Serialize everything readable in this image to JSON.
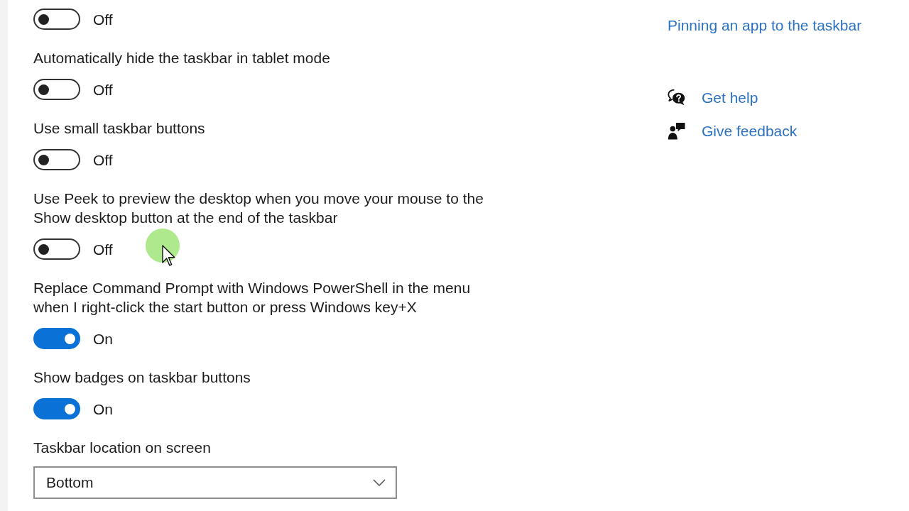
{
  "settings": [
    {
      "kind": "toggle",
      "on": false,
      "state_text": "Off"
    },
    {
      "kind": "toggle",
      "label": "Automatically hide the taskbar in tablet mode",
      "on": false,
      "state_text": "Off"
    },
    {
      "kind": "toggle",
      "label": "Use small taskbar buttons",
      "on": false,
      "state_text": "Off"
    },
    {
      "kind": "toggle",
      "label": "Use Peek to preview the desktop when you move your mouse to the Show desktop button at the end of the taskbar",
      "on": false,
      "state_text": "Off"
    },
    {
      "kind": "toggle",
      "label": "Replace Command Prompt with Windows PowerShell in the menu when I right-click the start button or press Windows key+X",
      "on": true,
      "state_text": "On"
    },
    {
      "kind": "toggle",
      "label": "Show badges on taskbar buttons",
      "on": true,
      "state_text": "On"
    },
    {
      "kind": "dropdown",
      "label": "Taskbar location on screen",
      "value": "Bottom"
    }
  ],
  "related_links": [
    {
      "text": "Pinning an app to the taskbar"
    }
  ],
  "help_links": [
    {
      "kind": "help",
      "text": "Get help"
    },
    {
      "kind": "feedback",
      "text": "Give feedback"
    }
  ]
}
